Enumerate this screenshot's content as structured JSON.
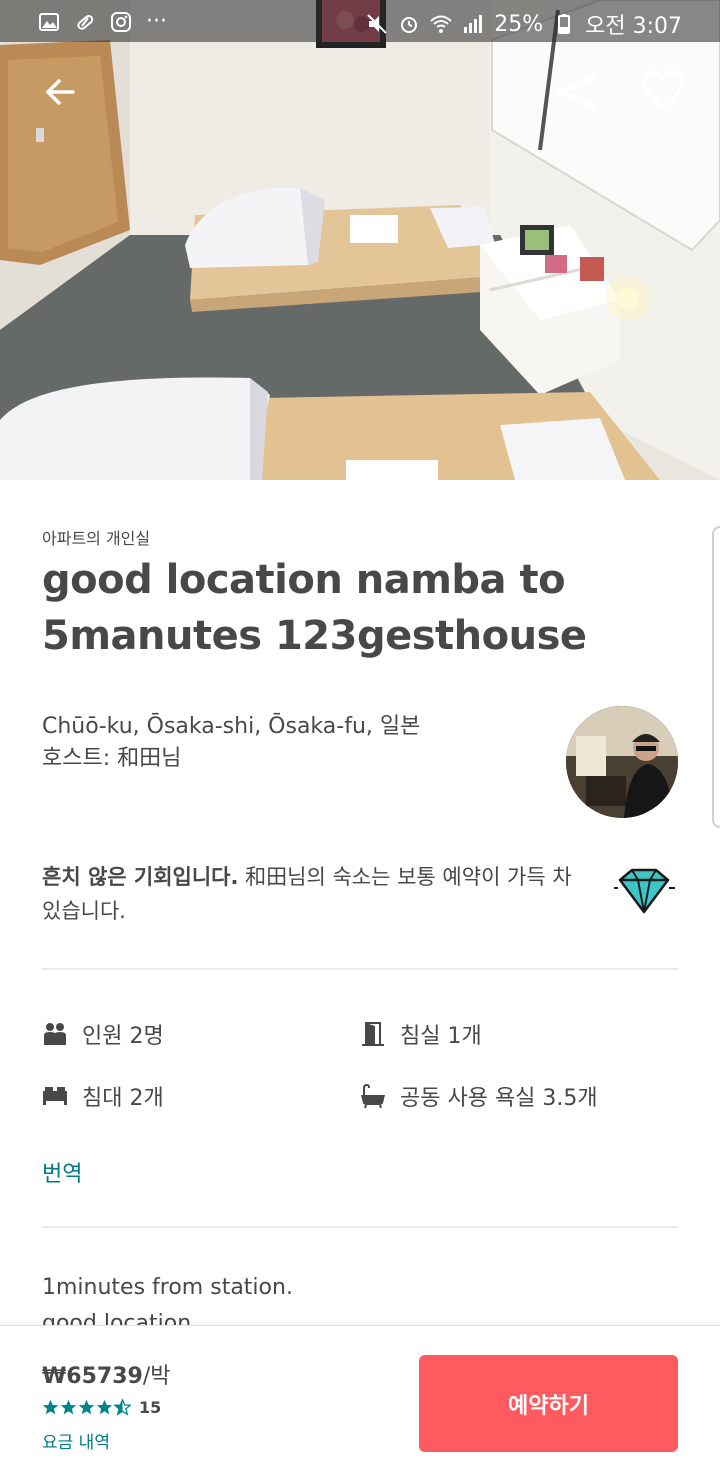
{
  "status_bar": {
    "battery": "25%",
    "time": "오전 3:07"
  },
  "listing": {
    "room_type": "아파트의 개인실",
    "title": "good location  namba to 5manutes 123gesthouse",
    "location": "Chūō-ku, Ōsaka-shi, Ōsaka-fu, 일본",
    "host": "호스트: 和田님"
  },
  "rare_find": {
    "bold": "흔치 않은 기회입니다.",
    "text": " 和田님의 숙소는 보통 예약이 가득 차 있습니다."
  },
  "amenities": {
    "guests": "인원 2명",
    "bedrooms": "침실 1개",
    "beds": "침대 2개",
    "baths": "공동 사용 욕실 3.5개"
  },
  "translate_label": "번역",
  "description": {
    "line1": "1minutes from station.",
    "line2": "good location"
  },
  "booking": {
    "price": "₩65739",
    "per_night": "/박",
    "rating": 4.5,
    "review_count": "15",
    "price_detail": "요금 내역",
    "book_label": "예약하기"
  },
  "colors": {
    "accent": "#ff5a5f",
    "link": "#007a87",
    "stars": "#008489"
  }
}
